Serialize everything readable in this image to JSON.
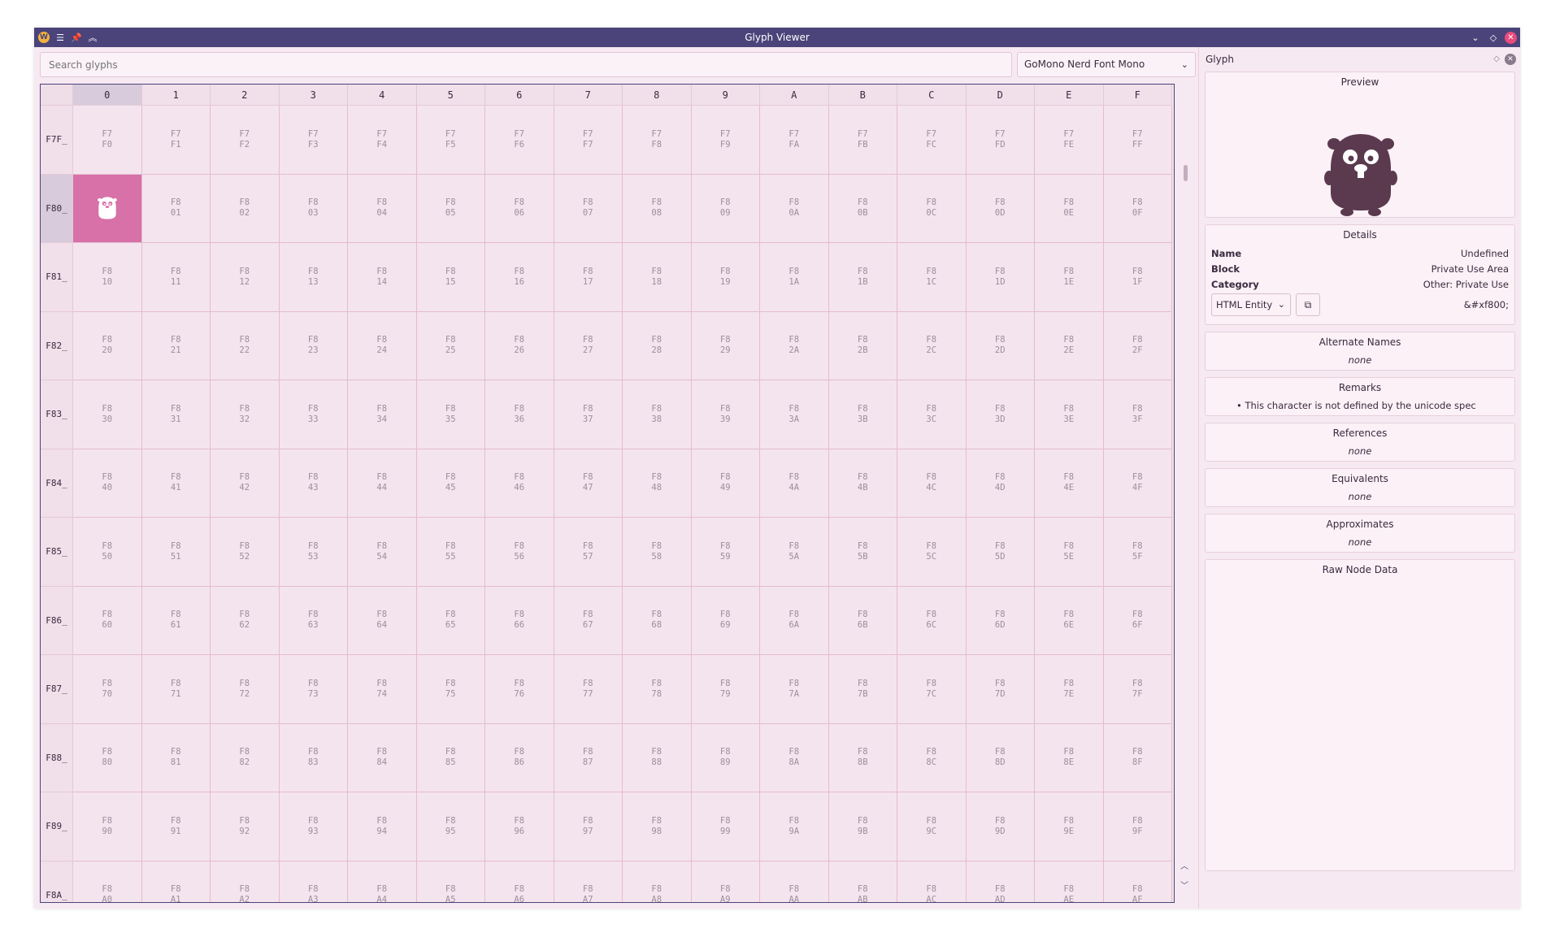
{
  "window": {
    "title": "Glyph Viewer",
    "app_icon": "W"
  },
  "search": {
    "placeholder": "Search glyphs"
  },
  "font_select": {
    "value": "GoMono Nerd Font Mono"
  },
  "grid": {
    "columns": [
      "0",
      "1",
      "2",
      "3",
      "4",
      "5",
      "6",
      "7",
      "8",
      "9",
      "A",
      "B",
      "C",
      "D",
      "E",
      "F"
    ],
    "rows": [
      "F7F_",
      "F80_",
      "F81_",
      "F82_",
      "F83_",
      "F84_",
      "F85_",
      "F86_",
      "F87_",
      "F88_",
      "F89_",
      "F8A_"
    ],
    "selected": {
      "row": 1,
      "col": 0
    },
    "active_column": 0,
    "active_row": 1
  },
  "panel": {
    "title": "Glyph",
    "preview": {
      "title": "Preview"
    },
    "details": {
      "title": "Details",
      "name_label": "Name",
      "name": "Undefined",
      "block_label": "Block",
      "block": "Private Use Area",
      "category_label": "Category",
      "category": "Other: Private Use",
      "entity_format": "HTML Entity",
      "entity_value": "&#xf800;"
    },
    "alternate_names": {
      "title": "Alternate Names",
      "value": "none"
    },
    "remarks": {
      "title": "Remarks",
      "items": [
        "This character is not defined by the unicode spec"
      ]
    },
    "references": {
      "title": "References",
      "value": "none"
    },
    "equivalents": {
      "title": "Equivalents",
      "value": "none"
    },
    "approximates": {
      "title": "Approximates",
      "value": "none"
    },
    "raw": {
      "title": "Raw Node Data"
    }
  },
  "colors": {
    "titlebar": "#4a447a",
    "selection": "#d771a8",
    "glyph": "#5b3a4f"
  }
}
